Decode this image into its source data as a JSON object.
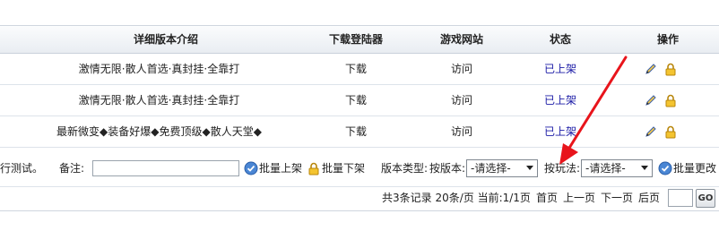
{
  "table": {
    "headers": [
      "详细版本介绍",
      "下载登陆器",
      "游戏网站",
      "状态",
      "操作"
    ],
    "rows": [
      {
        "intro": "激情无限·散人首选·真封挂·全靠打",
        "download": "下载",
        "website": "访问",
        "status": "已上架"
      },
      {
        "intro": "激情无限·散人首选·真封挂·全靠打",
        "download": "下载",
        "website": "访问",
        "status": "已上架"
      },
      {
        "intro": "最新微变◆装备好爆◆免费顶级◆散人天堂◆",
        "download": "下载",
        "website": "访问",
        "status": "已上架"
      }
    ]
  },
  "toolbar": {
    "left_fragment": "行测试。",
    "remark_label": "备注:",
    "remark_value": "",
    "batch_on_label": "批量上架",
    "batch_off_label": "批量下架",
    "version_type_label": "版本类型:",
    "by_version_label": "按版本:",
    "by_version_value": "-请选择-",
    "by_play_label": "按玩法:",
    "by_play_value": "-请选择-",
    "batch_change_label": "批量更改"
  },
  "pager": {
    "summary": "共3条记录 20条/页 当前:1/1页",
    "first": "首页",
    "prev": "上一页",
    "next": "下一页",
    "last": "后页",
    "page_value": "",
    "go_label": "GO"
  },
  "colors": {
    "status": "#1a1aa6",
    "annotation_arrow": "#e8141b"
  }
}
